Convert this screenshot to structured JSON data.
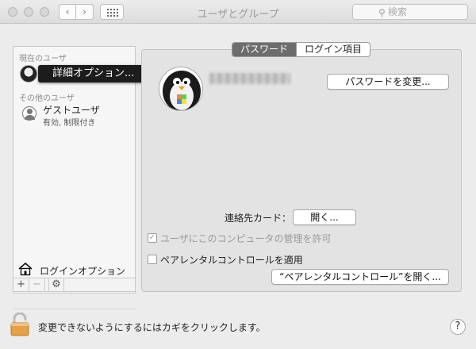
{
  "window": {
    "title": "ユーザとグループ"
  },
  "toolbar": {
    "back_glyph": "‹",
    "forward_glyph": "›",
    "grid_icon": "grid-icon"
  },
  "search": {
    "placeholder": "検索",
    "icon": "magnifier-icon"
  },
  "sidebar": {
    "current_users_label": "現在のユーザ",
    "tooltip": "詳細オプション...",
    "other_users_label": "その他のユーザ",
    "guest": {
      "name": "ゲストユーザ",
      "status": "有効, 制限付き"
    },
    "login_options": "ログインオプション",
    "add": "+",
    "remove": "−",
    "gear": "gear-icon"
  },
  "tabs": [
    {
      "label": "パスワード",
      "active": true
    },
    {
      "label": "ログイン項目",
      "active": false
    }
  ],
  "panel": {
    "change_password": "パスワードを変更...",
    "contact_card_label": "連絡先カード：",
    "open_button": "開く...",
    "admin_checkbox": {
      "label": "ユーザにこのコンピュータの管理を許可",
      "checked": true,
      "disabled": true
    },
    "parental_checkbox": {
      "label": "ペアレンタルコントロールを適用",
      "checked": false
    },
    "open_parental": "“ペアレンタルコントロール”を開く..."
  },
  "footer": {
    "lock_text": "変更できないようにするにはカギをクリックします。",
    "help": "?"
  }
}
